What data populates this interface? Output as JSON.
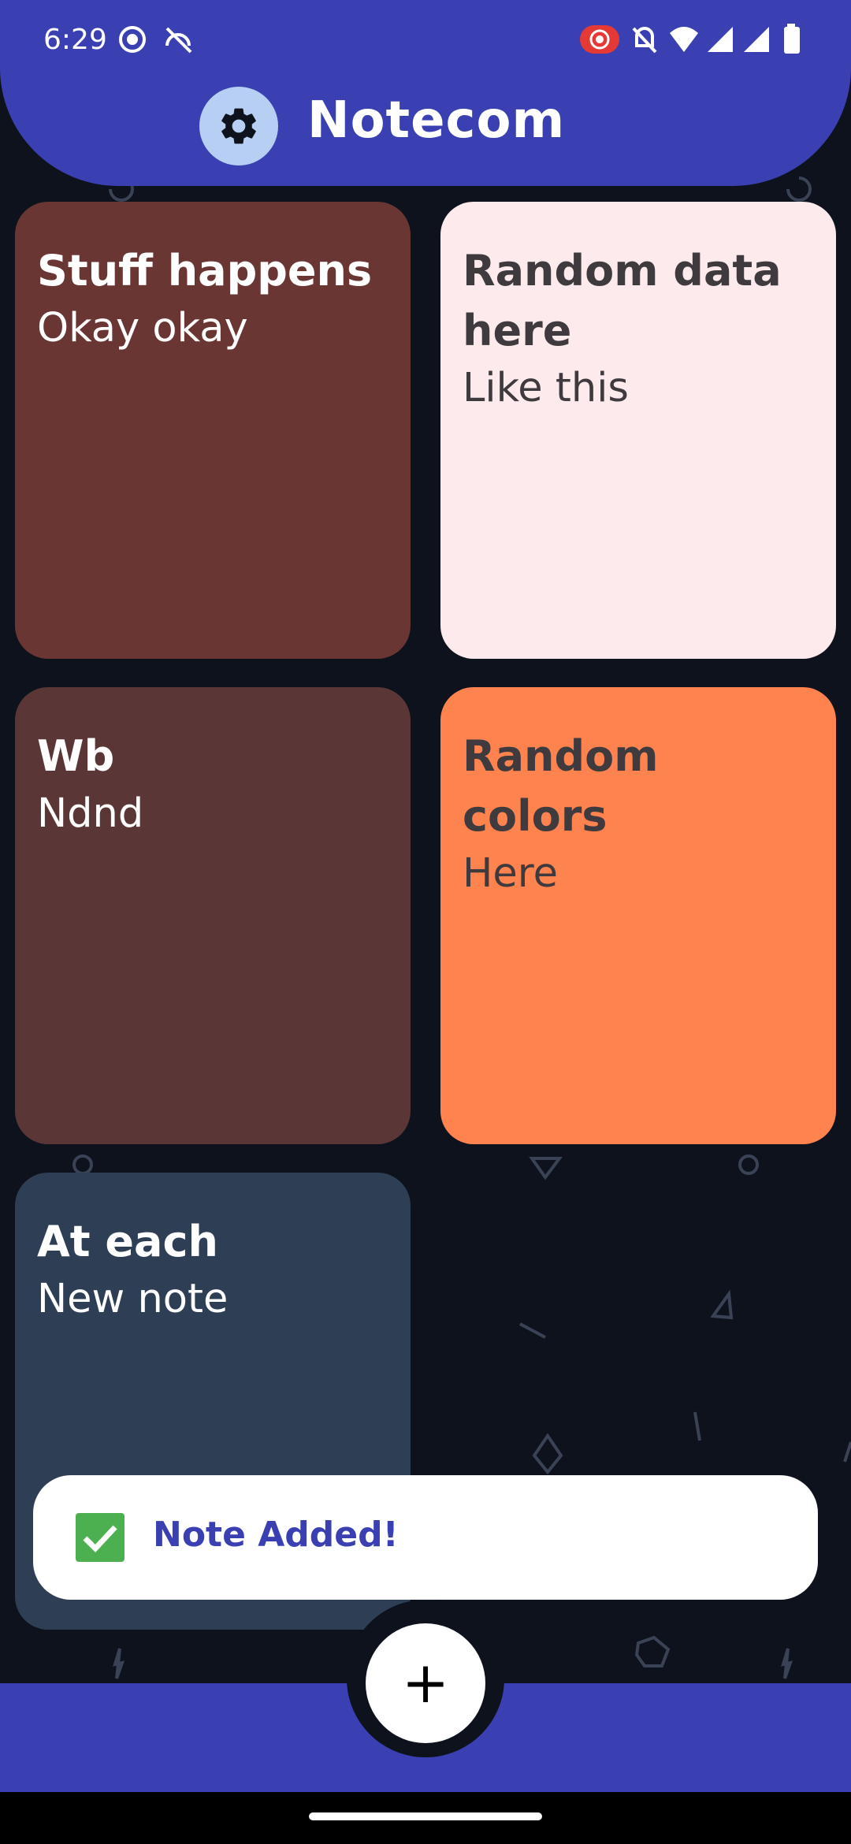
{
  "status_bar": {
    "time": "6:29",
    "icons": [
      "screen-record-icon",
      "sync-off-icon",
      "cast-recording-icon",
      "mute-icon",
      "wifi-icon",
      "signal-icon",
      "signal-icon",
      "battery-icon"
    ]
  },
  "header": {
    "title": "Notecom",
    "settings_icon": "gear-icon",
    "color": "#3a40b2"
  },
  "notes": [
    {
      "title": "Stuff happens",
      "body": "Okay okay",
      "color": "#6a3634"
    },
    {
      "title": "Random data here",
      "body": "Like this",
      "color": "#fdeaec"
    },
    {
      "title": "Wb",
      "body": "Ndnd",
      "color": "#5a3736"
    },
    {
      "title": "Random colors",
      "body": "Here",
      "color": "#ff834f"
    },
    {
      "title": "At each",
      "body": "New note",
      "color": "#2e3e55"
    }
  ],
  "toast": {
    "message": "Note Added!",
    "icon": "check-box-icon"
  },
  "fab": {
    "label": "+",
    "icon": "plus-icon"
  }
}
